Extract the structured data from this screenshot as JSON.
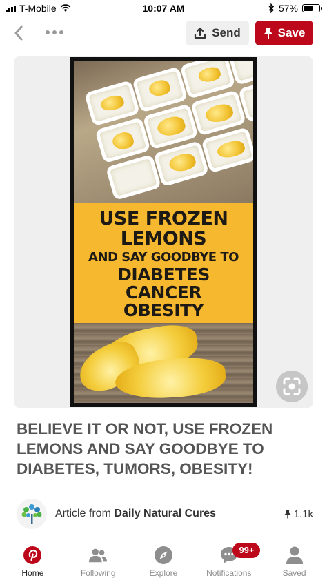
{
  "status_bar": {
    "carrier": "T-Mobile",
    "time": "10:07 AM",
    "battery_percent": "57%",
    "battery_level": 0.57
  },
  "toolbar": {
    "send_label": "Send",
    "save_label": "Save"
  },
  "pin_image": {
    "line1": "USE FROZEN",
    "line2": "LEMONS",
    "line3": "AND SAY GOODBYE TO",
    "line4": "DIABETES",
    "line5": "CANCER",
    "line6": "OBESITY"
  },
  "pin": {
    "title": "BELIEVE IT OR NOT, USE FROZEN LEMONS AND SAY GOODBYE TO DIABETES, TUMORS, OBESITY!",
    "source_prefix": "Article from",
    "source_name": "Daily Natural Cures",
    "save_count": "1.1k"
  },
  "tabs": [
    {
      "label": "Home"
    },
    {
      "label": "Following"
    },
    {
      "label": "Explore"
    },
    {
      "label": "Notifications",
      "badge": "99+"
    },
    {
      "label": "Saved"
    }
  ],
  "colors": {
    "brand_red": "#bd081c",
    "banner_yellow": "#f6b82f"
  }
}
